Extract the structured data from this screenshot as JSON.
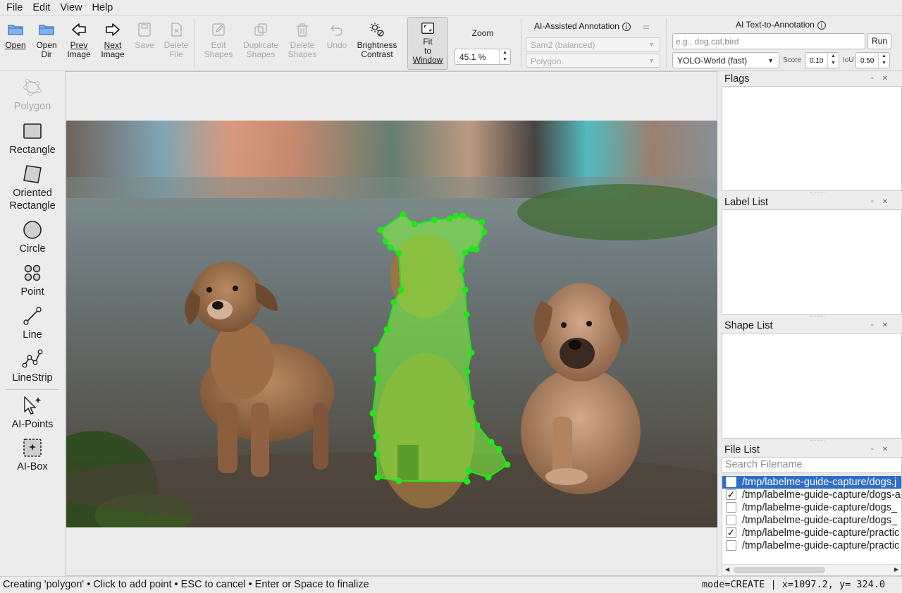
{
  "menu": [
    "File",
    "Edit",
    "View",
    "Help"
  ],
  "toolbar": {
    "open": "Open",
    "open_dir_1": "Open",
    "open_dir_2": "Dir",
    "prev_1": "Prev",
    "prev_2": "Image",
    "next_1": "Next",
    "next_2": "Image",
    "save": "Save",
    "delete_1": "Delete",
    "delete_2": "File",
    "edit_1": "Edit",
    "edit_2": "Shapes",
    "dup_1": "Duplicate",
    "dup_2": "Shapes",
    "del_1": "Delete",
    "del_2": "Shapes",
    "undo": "Undo",
    "bright_1": "Brightness",
    "bright_2": "Contrast",
    "fit_1": "Fit",
    "fit_2": "to",
    "fit_3": "Window",
    "zoom_label": "Zoom",
    "zoom_value": "45.1 %"
  },
  "ai_annotation": {
    "title": "AI-Assisted Annotation",
    "model": "Sam2 (balanced)",
    "output": "Polygon"
  },
  "ai_text": {
    "title": "AI Text-to-Annotation",
    "placeholder": "e.g., dog,cat,bird",
    "run": "Run",
    "model": "YOLO-World (fast)",
    "score_label": "Score",
    "score_value": "0.10",
    "iou_label": "IoU",
    "iou_value": "0.50"
  },
  "tools": {
    "polygon": "Polygon",
    "rectangle": "Rectangle",
    "oriented_1": "Oriented",
    "oriented_2": "Rectangle",
    "circle": "Circle",
    "point": "Point",
    "line": "Line",
    "linestrip": "LineStrip",
    "ai_points": "AI-Points",
    "ai_box": "AI-Box"
  },
  "docks": {
    "flags": "Flags",
    "label_list": "Label List",
    "shape_list": "Shape List",
    "file_list": "File List",
    "search_placeholder": "Search Filename"
  },
  "files": [
    {
      "name": "/tmp/labelme-guide-capture/dogs.j",
      "checked": false,
      "selected": true
    },
    {
      "name": "/tmp/labelme-guide-capture/dogs-a",
      "checked": true,
      "selected": false
    },
    {
      "name": "/tmp/labelme-guide-capture/dogs_",
      "checked": false,
      "selected": false
    },
    {
      "name": "/tmp/labelme-guide-capture/dogs_",
      "checked": false,
      "selected": false
    },
    {
      "name": "/tmp/labelme-guide-capture/practic",
      "checked": true,
      "selected": false
    },
    {
      "name": "/tmp/labelme-guide-capture/practic",
      "checked": false,
      "selected": false
    }
  ],
  "status": {
    "left": "Creating 'polygon' • Click to add point • ESC to cancel • Enter or Space to finalize",
    "right": "mode=CREATE | x=1097.2, y= 324.0"
  },
  "colors": {
    "selection": "#2f6dc6",
    "polygon_fill": "#7dff3c",
    "polygon_vertex": "#22e51a"
  }
}
